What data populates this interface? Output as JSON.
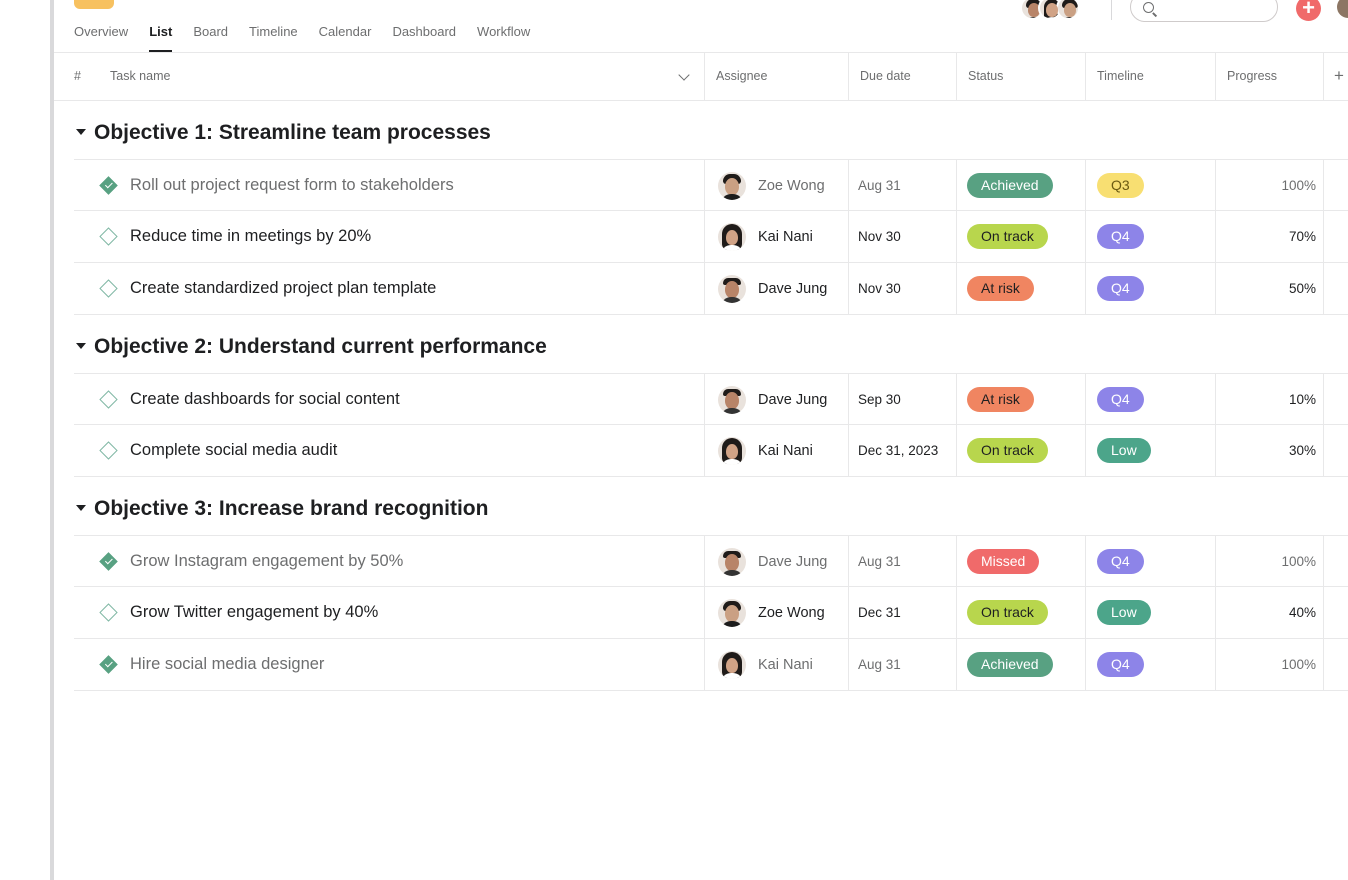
{
  "tabs": [
    "Overview",
    "List",
    "Board",
    "Timeline",
    "Calendar",
    "Dashboard",
    "Workflow"
  ],
  "active_tab": "List",
  "header": {
    "hash": "#",
    "task_name": "Task name",
    "assignee": "Assignee",
    "due_date": "Due date",
    "status": "Status",
    "timeline": "Timeline",
    "progress": "Progress",
    "add_column": "+"
  },
  "topbar": {
    "add_button_label": "+",
    "search_placeholder": ""
  },
  "colors": {
    "achieved": "#58a182",
    "on_track": "#b8d64d",
    "at_risk": "#f08561",
    "missed": "#f06a6a",
    "q3": "#f8df72",
    "q4": "#8d84e8",
    "low": "#4ca58a"
  },
  "sections": [
    {
      "title": "Objective 1: Streamline team processes",
      "tasks": [
        {
          "name": "Roll out project request form to stakeholders",
          "done": true,
          "assignee": "Zoe Wong",
          "avatar": "zoe",
          "due": "Aug 31",
          "status": "Achieved",
          "timeline": "Q3",
          "progress": "100%"
        },
        {
          "name": "Reduce time in meetings by 20%",
          "done": false,
          "assignee": "Kai Nani",
          "avatar": "kai",
          "due": "Nov 30",
          "status": "On track",
          "timeline": "Q4",
          "progress": "70%"
        },
        {
          "name": "Create standardized project plan template",
          "done": false,
          "assignee": "Dave Jung",
          "avatar": "dave",
          "due": "Nov 30",
          "status": "At risk",
          "timeline": "Q4",
          "progress": "50%"
        }
      ]
    },
    {
      "title": "Objective 2: Understand current performance",
      "tasks": [
        {
          "name": "Create dashboards for social content",
          "done": false,
          "assignee": "Dave Jung",
          "avatar": "dave",
          "due": "Sep 30",
          "status": "At risk",
          "timeline": "Q4",
          "progress": "10%"
        },
        {
          "name": "Complete social media audit",
          "done": false,
          "assignee": "Kai Nani",
          "avatar": "kai",
          "due": "Dec 31, 2023",
          "status": "On track",
          "timeline": "Low",
          "progress": "30%"
        }
      ]
    },
    {
      "title": "Objective 3: Increase brand recognition",
      "tasks": [
        {
          "name": "Grow Instagram engagement by 50%",
          "done": true,
          "assignee": "Dave Jung",
          "avatar": "dave",
          "due": "Aug 31",
          "status": "Missed",
          "timeline": "Q4",
          "progress": "100%"
        },
        {
          "name": "Grow Twitter engagement by 40%",
          "done": false,
          "assignee": "Zoe Wong",
          "avatar": "zoe",
          "due": "Dec 31",
          "status": "On track",
          "timeline": "Low",
          "progress": "40%"
        },
        {
          "name": "Hire social media designer",
          "done": true,
          "assignee": "Kai Nani",
          "avatar": "kai",
          "due": "Aug 31",
          "status": "Achieved",
          "timeline": "Q4",
          "progress": "100%"
        }
      ]
    }
  ]
}
